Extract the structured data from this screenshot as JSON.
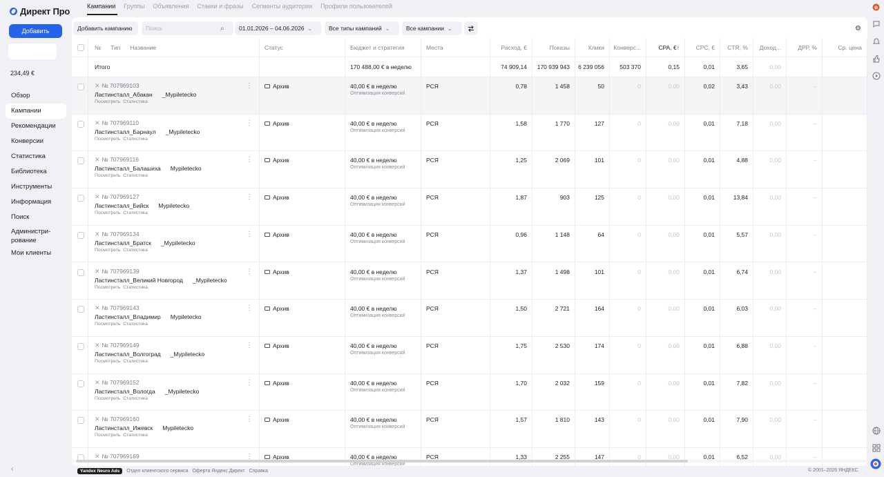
{
  "app": {
    "logo_text": "Директ Про",
    "add_button": "Добавить",
    "balance": "234,49 €"
  },
  "nav": [
    {
      "label": "Обзор",
      "active": false
    },
    {
      "label": "Кампании",
      "active": true
    },
    {
      "label": "Рекомендации",
      "active": false
    },
    {
      "label": "Конверсии",
      "active": false
    },
    {
      "label": "Статистика",
      "active": false
    },
    {
      "label": "Библиотека",
      "active": false
    },
    {
      "label": "Инструменты",
      "active": false
    },
    {
      "label": "Информация",
      "active": false
    },
    {
      "label": "Поиск",
      "active": false
    },
    {
      "label": "Администри-\nрование",
      "active": false
    },
    {
      "label": "Мои клиенты",
      "active": false
    }
  ],
  "collapse_glyph": "‹",
  "tabs": [
    {
      "label": "Кампании",
      "active": true
    },
    {
      "label": "Группы"
    },
    {
      "label": "Объявления"
    },
    {
      "label": "Ставки и фразы"
    },
    {
      "label": "Сегменты аудитории"
    },
    {
      "label": "Профили пользователей"
    }
  ],
  "toolbar": {
    "add_campaign": "Добавить кампанию",
    "search_placeholder": "Поиск",
    "date_range": "01.01.2026 – 04.06.2026",
    "type_filter": "Все типы кампаний",
    "status_filter": "Все кампании"
  },
  "columns": {
    "num": "№",
    "type": "Тип",
    "name": "Название",
    "status": "Статус",
    "budget": "Бюджет и стратегия",
    "places": "Места",
    "spend": "Расход, €",
    "impressions": "Показы",
    "clicks": "Клики",
    "conversions": "Конверс...",
    "cpa": "CPA, €↑",
    "cpc": "CPC, €",
    "ctr": "CTR, %",
    "income": "Доход...",
    "drr": "ДРР, %",
    "avg": "Ср. цена"
  },
  "totals": {
    "label": "Итого",
    "budget": "170 488,00 € в неделю",
    "spend": "74 909,14",
    "impressions": "170 939 943",
    "clicks": "6 239 056",
    "conversions": "503 370",
    "cpa": "0,15",
    "cpc": "0,01",
    "ctr": "3,65",
    "income": "0,00"
  },
  "row_common": {
    "links": "Посмотреть  Статистика",
    "status": "Архив",
    "budget": "40,00 € в неделю",
    "strategy": "Оптимизация конверсий",
    "place": "РСЯ",
    "zero": "0",
    "cpa": "0,00",
    "income": "0,00",
    "drr": "–"
  },
  "campaigns": [
    {
      "id": "№ 707969103",
      "name": "Ластинсталл_Абакан",
      "suffix": "_Mypiletecko",
      "spend": "0,78",
      "impressions": "1 458",
      "clicks": "50",
      "cpc": "0,02",
      "ctr": "3,43"
    },
    {
      "id": "№ 707969110",
      "name": "Ластинсталл_Барнаул",
      "suffix": "_Mypiletecko",
      "spend": "1,58",
      "impressions": "1 770",
      "clicks": "127",
      "cpc": "0,01",
      "ctr": "7,18"
    },
    {
      "id": "№ 707969116",
      "name": "Ластинсталл_Балашиха",
      "suffix": "Mypiletecko",
      "spend": "1,25",
      "impressions": "2 069",
      "clicks": "101",
      "cpc": "0,01",
      "ctr": "4,88"
    },
    {
      "id": "№ 707969127",
      "name": "Ластинсталл_Бийск",
      "suffix": "Mypiletecko",
      "spend": "1,87",
      "impressions": "903",
      "clicks": "125",
      "cpc": "0,01",
      "ctr": "13,84"
    },
    {
      "id": "№ 707969134",
      "name": "Ластинсталл_Братск",
      "suffix": "_Mypiletecko",
      "spend": "0,96",
      "impressions": "1 148",
      "clicks": "64",
      "cpc": "0,01",
      "ctr": "5,57"
    },
    {
      "id": "№ 707969139",
      "name": "Ластинсталл_Великий Новгород",
      "suffix": "_Mypiletecko",
      "spend": "1,37",
      "impressions": "1 498",
      "clicks": "101",
      "cpc": "0,01",
      "ctr": "6,74"
    },
    {
      "id": "№ 707969143",
      "name": "Ластинсталл_Владимир",
      "suffix": "Mypiletecko",
      "spend": "1,50",
      "impressions": "2 721",
      "clicks": "164",
      "cpc": "0,01",
      "ctr": "6,03"
    },
    {
      "id": "№ 707969149",
      "name": "Ластинсталл_Волгоград",
      "suffix": "_Mypiletecko",
      "spend": "1,75",
      "impressions": "2 530",
      "clicks": "174",
      "cpc": "0,01",
      "ctr": "6,88"
    },
    {
      "id": "№ 707969152",
      "name": "Ластинсталл_Вологда",
      "suffix": "_Mypiletecko",
      "spend": "1,70",
      "impressions": "2 032",
      "clicks": "159",
      "cpc": "0,01",
      "ctr": "7,82"
    },
    {
      "id": "№ 707969160",
      "name": "Ластинсталл_Ижевск",
      "suffix": "Mypiletecko",
      "spend": "1,57",
      "impressions": "1 810",
      "clicks": "143",
      "cpc": "0,01",
      "ctr": "7,90"
    },
    {
      "id": "№ 707969169",
      "name": "",
      "suffix": "",
      "spend": "1,33",
      "impressions": "2 255",
      "clicks": "147",
      "cpc": "0,01",
      "ctr": "6,52"
    }
  ],
  "footer": {
    "badge": "Yandex Neuro Ads",
    "links": [
      "Отдел клиентского сервиса",
      "Оферта Яндекс Директ",
      "Справка"
    ],
    "copyright": "© 2001–2026 ЯНДЕКС"
  },
  "colors": {
    "accent": "#2563ea",
    "background": "#f0f1f4"
  }
}
